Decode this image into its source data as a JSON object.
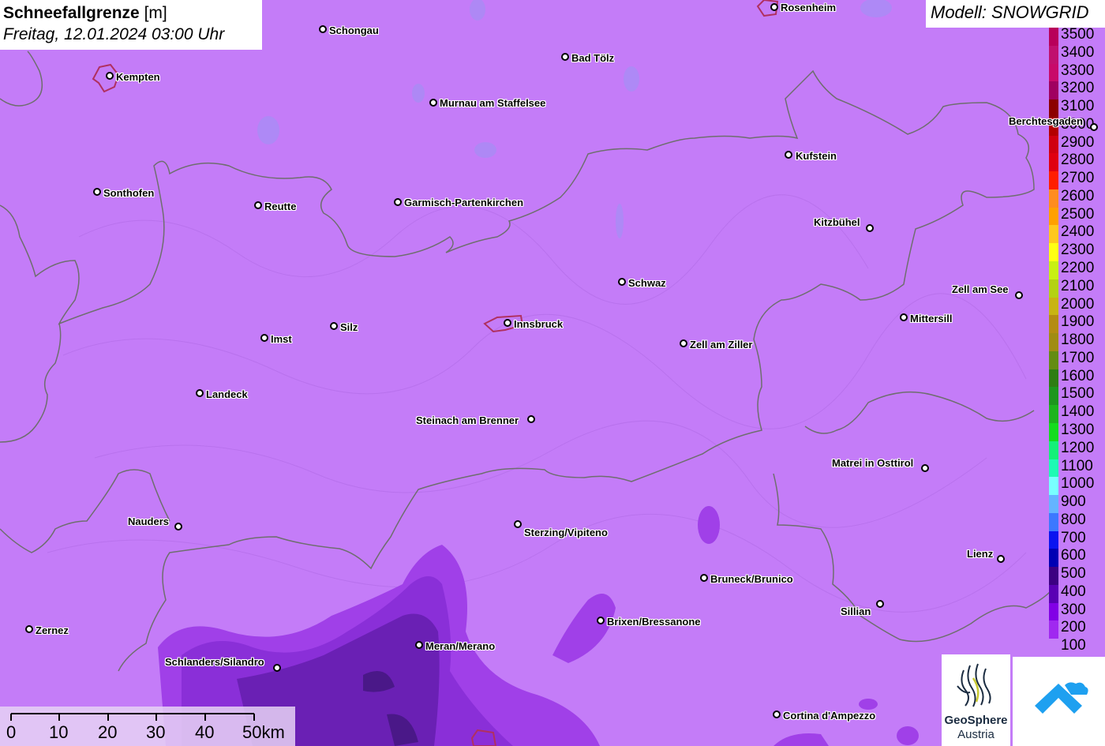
{
  "title": {
    "main": "Schneefallgrenze",
    "unit": "[m]",
    "datetime": "Freitag, 12.01.2024 03:00 Uhr"
  },
  "model": "Modell: SNOWGRID",
  "legend": {
    "labels": [
      "3500",
      "3400",
      "3300",
      "3200",
      "3100",
      "3000",
      "2900",
      "2800",
      "2700",
      "2600",
      "2500",
      "2400",
      "2300",
      "2200",
      "2100",
      "2000",
      "1900",
      "1800",
      "1700",
      "1600",
      "1500",
      "1400",
      "1300",
      "1200",
      "1100",
      "1000",
      "900",
      "800",
      "700",
      "600",
      "500",
      "400",
      "300",
      "200",
      "100"
    ],
    "colors": [
      "#b8005a",
      "#c0106e",
      "#c80a6a",
      "#a00060",
      "#8c0000",
      "#b40000",
      "#d00010",
      "#e00010",
      "#ff1e00",
      "#ff8c1e",
      "#ffa000",
      "#ffc81e",
      "#ffff14",
      "#c8f014",
      "#b4d214",
      "#c8b414",
      "#b48c14",
      "#a08c14",
      "#648c14",
      "#2e7d14",
      "#1e961e",
      "#1eb41e",
      "#14dc1e",
      "#14f078",
      "#1efab4",
      "#78ffff",
      "#64b4ff",
      "#3c78ff",
      "#0a14f0",
      "#0000b4",
      "#3c0082",
      "#5a00b4",
      "#8200e6",
      "#a028f0",
      "#c47cf8"
    ]
  },
  "cities": [
    {
      "name": "Rosenheim"
    },
    {
      "name": "Schongau"
    },
    {
      "name": "Bad Tölz"
    },
    {
      "name": "Kempten"
    },
    {
      "name": "Murnau am Staffelsee"
    },
    {
      "name": "Berchtesgaden"
    },
    {
      "name": "Kufstein"
    },
    {
      "name": "Sonthofen"
    },
    {
      "name": "Reutte"
    },
    {
      "name": "Garmisch-Partenkirchen"
    },
    {
      "name": "Kitzbühel"
    },
    {
      "name": "Schwaz"
    },
    {
      "name": "Zell am See"
    },
    {
      "name": "Mittersill"
    },
    {
      "name": "Innsbruck"
    },
    {
      "name": "Silz"
    },
    {
      "name": "Imst"
    },
    {
      "name": "Zell am Ziller"
    },
    {
      "name": "Landeck"
    },
    {
      "name": "Steinach am Brenner"
    },
    {
      "name": "Matrei in Osttirol"
    },
    {
      "name": "Nauders"
    },
    {
      "name": "Sterzing/Vipiteno"
    },
    {
      "name": "Lienz"
    },
    {
      "name": "Bruneck/Brunico"
    },
    {
      "name": "Sillian"
    },
    {
      "name": "Brixen/Bressanone"
    },
    {
      "name": "Zernez"
    },
    {
      "name": "Meran/Merano"
    },
    {
      "name": "Schlanders/Silandro"
    },
    {
      "name": "Cortina d'Ampezzo"
    }
  ],
  "scale_bar": {
    "labels": [
      "0",
      "10",
      "20",
      "30",
      "40",
      "50km"
    ]
  },
  "logos": {
    "geosphere_line1": "GeoSphere",
    "geosphere_line2": "Austria"
  }
}
